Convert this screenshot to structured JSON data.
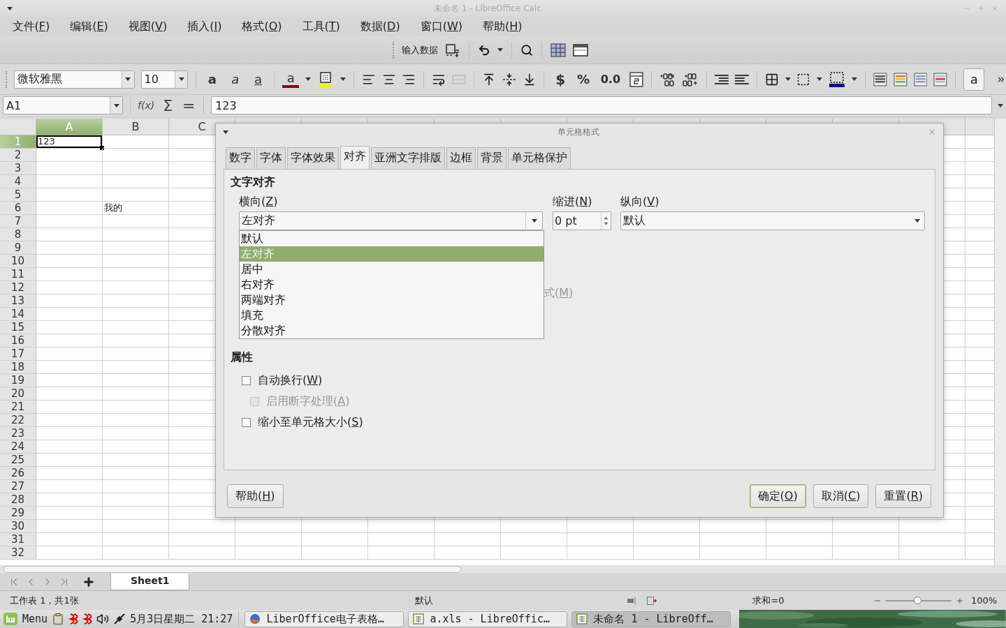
{
  "window": {
    "title": "未命名 1 - LibreOffice Calc"
  },
  "menu": [
    {
      "text": "文件(F)"
    },
    {
      "text": "编辑(E)"
    },
    {
      "text": "视图(V)"
    },
    {
      "text": "插入(I)"
    },
    {
      "text": "格式(O)"
    },
    {
      "text": "工具(T)"
    },
    {
      "text": "数据(D)"
    },
    {
      "text": "窗口(W)"
    },
    {
      "text": "帮助(H)"
    }
  ],
  "standard_toolbar": {
    "label": "输入数据"
  },
  "format_toolbar": {
    "font_name": "微软雅黑",
    "font_size": "10",
    "glyphs": [
      "a",
      "a",
      "a",
      "a",
      "$",
      "%",
      "0.0",
      "a"
    ],
    "merge_cells_disabled": true,
    "autofit_on": true
  },
  "formula_bar": {
    "name_box": "A1",
    "function_wizard": "f(x)",
    "sum": "Σ",
    "equals": "=",
    "value": "123"
  },
  "grid": {
    "columns": [
      {
        "label": "A",
        "selected": true
      },
      {
        "label": "B",
        "selected": false
      },
      {
        "label": "C",
        "selected": false
      }
    ],
    "rows": [
      {
        "label": "1",
        "selected": true,
        "a": "123"
      },
      {
        "label": "2",
        "selected": false
      },
      {
        "label": "3",
        "selected": false
      },
      {
        "label": "4",
        "selected": false
      },
      {
        "label": "5",
        "selected": false
      },
      {
        "label": "6",
        "selected": false,
        "b": "我的"
      },
      {
        "label": "7",
        "selected": false
      },
      {
        "label": "8",
        "selected": false
      },
      {
        "label": "9",
        "selected": false
      },
      {
        "label": "10",
        "selected": false
      },
      {
        "label": "11",
        "selected": false
      },
      {
        "label": "12",
        "selected": false
      },
      {
        "label": "13",
        "selected": false
      },
      {
        "label": "14",
        "selected": false
      },
      {
        "label": "15",
        "selected": false
      },
      {
        "label": "16",
        "selected": false
      },
      {
        "label": "17",
        "selected": false
      },
      {
        "label": "18",
        "selected": false
      },
      {
        "label": "19",
        "selected": false
      },
      {
        "label": "20",
        "selected": false
      },
      {
        "label": "21",
        "selected": false
      },
      {
        "label": "22",
        "selected": false
      },
      {
        "label": "23",
        "selected": false
      },
      {
        "label": "24",
        "selected": false
      },
      {
        "label": "25",
        "selected": false
      },
      {
        "label": "26",
        "selected": false
      },
      {
        "label": "27",
        "selected": false
      },
      {
        "label": "28",
        "selected": false
      },
      {
        "label": "29",
        "selected": false
      },
      {
        "label": "30",
        "selected": false
      },
      {
        "label": "31",
        "selected": false
      },
      {
        "label": "32",
        "selected": false
      }
    ]
  },
  "dialog": {
    "title": "单元格格式",
    "tabs": [
      {
        "label": "数字",
        "selected": false
      },
      {
        "label": "字体",
        "selected": false
      },
      {
        "label": "字体效果",
        "selected": false
      },
      {
        "label": "对齐",
        "selected": true
      },
      {
        "label": "亚洲文字排版",
        "selected": false
      },
      {
        "label": "边框",
        "selected": false
      },
      {
        "label": "背景",
        "selected": false
      },
      {
        "label": "单元格保护",
        "selected": false
      }
    ],
    "alignment_heading": "文字对齐",
    "horizontal": {
      "label": {
        "text": "横向(Z)"
      },
      "value": "左对齐",
      "expanded": true,
      "options": [
        {
          "label": "默认",
          "selected": false
        },
        {
          "label": "左对齐",
          "selected": true
        },
        {
          "label": "居中",
          "selected": false
        },
        {
          "label": "右对齐",
          "selected": false
        },
        {
          "label": "两端对齐",
          "selected": false
        },
        {
          "label": "填充",
          "selected": false
        },
        {
          "label": "分散对齐",
          "selected": false
        }
      ]
    },
    "indent": {
      "label": {
        "text": "缩进(N)"
      },
      "value": "0 pt"
    },
    "vertical": {
      "label": {
        "text": "纵向(V)"
      },
      "value": "默认"
    },
    "direction_option": {
      "text": "式(M)"
    },
    "properties_heading": "属性",
    "checkboxes": [
      {
        "text": "自动换行(W)",
        "checked": false,
        "disabled": false,
        "children": [
          {
            "text": "启用断字处理(A)",
            "checked": false,
            "disabled": true
          }
        ]
      },
      {
        "text": "缩小至单元格大小(S)",
        "checked": false,
        "disabled": false
      }
    ],
    "buttons": [
      {
        "text": "帮助(H)",
        "default": false
      },
      {
        "text": "确定(O)",
        "default": true
      },
      {
        "text": "取消(C)",
        "default": false
      },
      {
        "text": "重置(R)",
        "default": false
      }
    ]
  },
  "sheet_tabs": [
    {
      "label": "Sheet1",
      "selected": true
    }
  ],
  "status_bar": {
    "sheet": "工作表 1，共1张",
    "style": "默认",
    "sum": "求和=0",
    "zoom": {
      "level": 0.48
    },
    "zoom_percent": "100%"
  },
  "taskbar": {
    "menu": "Menu",
    "clock": "5月3日星期二 21:27",
    "tasks": [
      {
        "label": "LiberOffice电子表格…",
        "kind": "browser",
        "selected": false
      },
      {
        "label": "a.xls - LibreOffic…",
        "kind": "spreadsheet",
        "selected": false
      },
      {
        "label": "未命名 1 - LibreOff…",
        "kind": "spreadsheet",
        "selected": true
      }
    ]
  }
}
